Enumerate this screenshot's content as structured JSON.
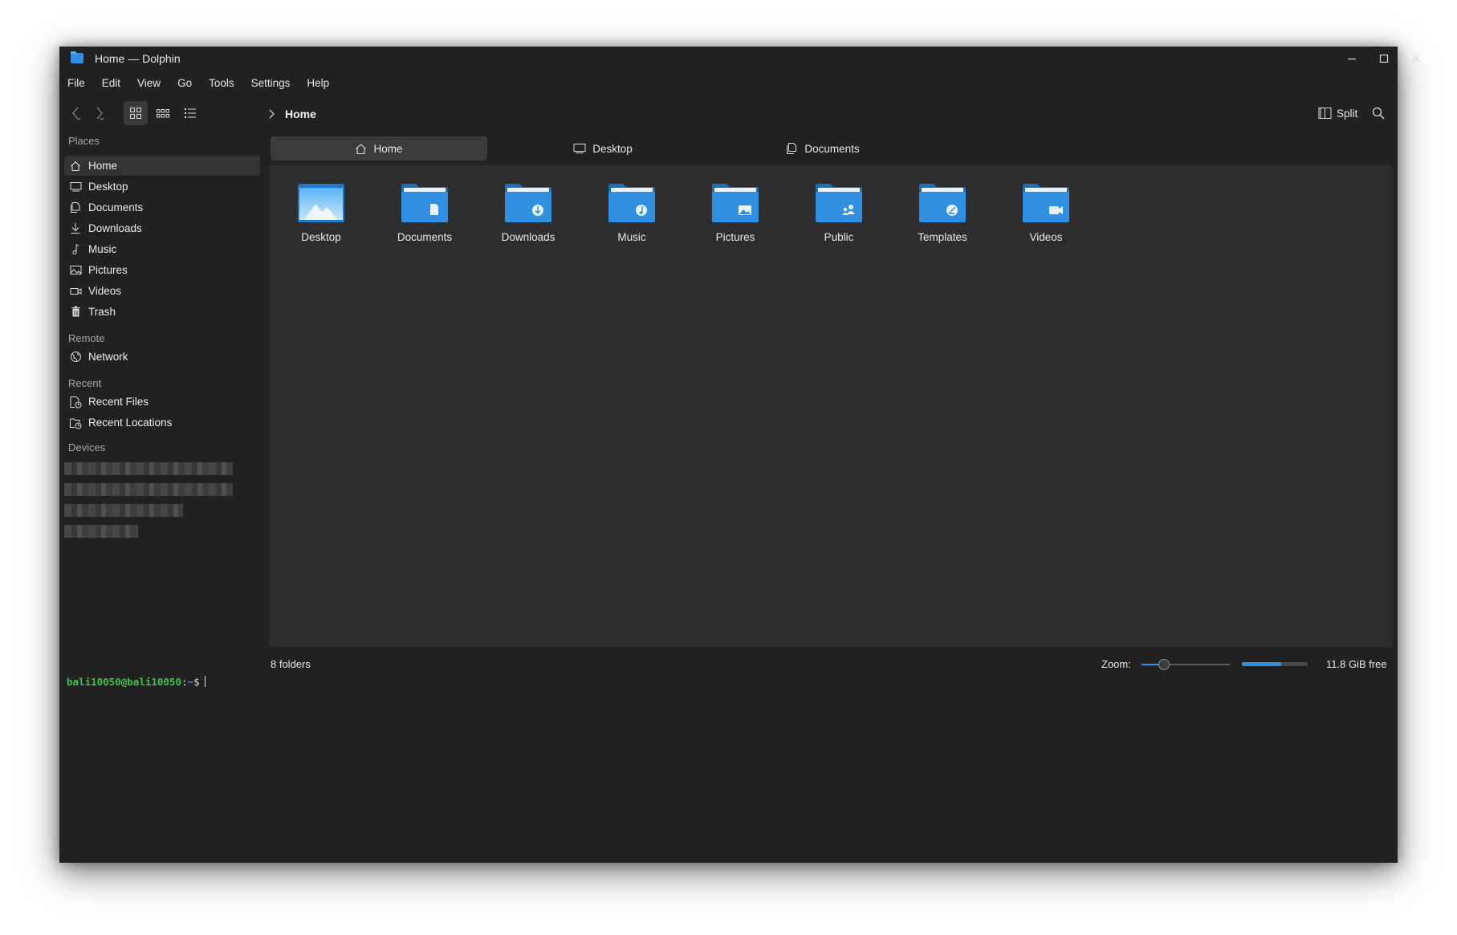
{
  "window": {
    "title": "Home — Dolphin"
  },
  "menu": [
    "File",
    "Edit",
    "View",
    "Go",
    "Tools",
    "Settings",
    "Help"
  ],
  "toolbar": {
    "breadcrumb": "Home",
    "split_label": "Split",
    "active_view": "icons"
  },
  "sidebar": {
    "places_label": "Places",
    "places": [
      {
        "label": "Home",
        "icon": "home-icon",
        "selected": true
      },
      {
        "label": "Desktop",
        "icon": "desktop-icon"
      },
      {
        "label": "Documents",
        "icon": "documents-icon"
      },
      {
        "label": "Downloads",
        "icon": "download-icon"
      },
      {
        "label": "Music",
        "icon": "music-icon"
      },
      {
        "label": "Pictures",
        "icon": "pictures-icon"
      },
      {
        "label": "Videos",
        "icon": "videos-icon"
      },
      {
        "label": "Trash",
        "icon": "trash-icon"
      }
    ],
    "remote_label": "Remote",
    "remote": [
      {
        "label": "Network",
        "icon": "network-icon"
      }
    ],
    "recent_label": "Recent",
    "recent": [
      {
        "label": "Recent Files",
        "icon": "recent-files-icon"
      },
      {
        "label": "Recent Locations",
        "icon": "recent-locations-icon"
      }
    ],
    "devices_label": "Devices"
  },
  "tabs": [
    {
      "label": "Home",
      "icon": "home-icon",
      "active": true
    },
    {
      "label": "Desktop",
      "icon": "desktop-icon"
    },
    {
      "label": "Documents",
      "icon": "documents-icon"
    }
  ],
  "folders": [
    {
      "label": "Desktop",
      "emblem": "desktop"
    },
    {
      "label": "Documents",
      "emblem": "document"
    },
    {
      "label": "Downloads",
      "emblem": "download"
    },
    {
      "label": "Music",
      "emblem": "music"
    },
    {
      "label": "Pictures",
      "emblem": "picture"
    },
    {
      "label": "Public",
      "emblem": "public"
    },
    {
      "label": "Templates",
      "emblem": "template"
    },
    {
      "label": "Videos",
      "emblem": "video"
    }
  ],
  "status": {
    "folder_count": "8 folders",
    "zoom_label": "Zoom:",
    "zoom_level": 0.25,
    "used_space_fraction": 0.6,
    "free_space": "11.8 GiB free"
  },
  "terminal": {
    "user_host": "bali10050@bali10050",
    "sep": ":",
    "path": "~",
    "prompt": "$"
  },
  "colors": {
    "accent": "#2f8fe0",
    "window_bg": "#212121",
    "content_bg": "#2d2d2d",
    "terminal_user": "#3dc24a",
    "terminal_path": "#3b8eea"
  }
}
